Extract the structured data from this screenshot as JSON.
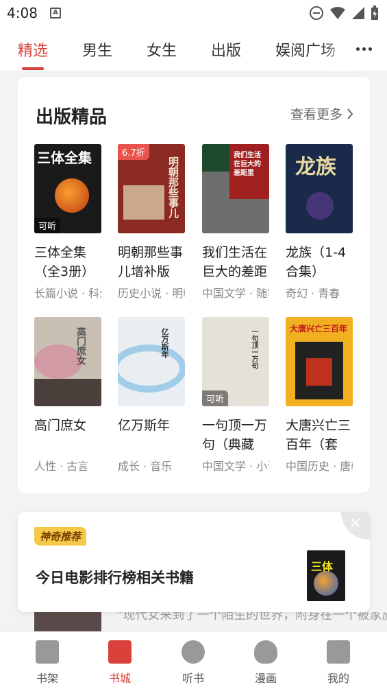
{
  "status": {
    "time": "4:08",
    "a_label": "A"
  },
  "tabs": [
    {
      "label": "精选",
      "active": true
    },
    {
      "label": "男生"
    },
    {
      "label": "女生"
    },
    {
      "label": "出版"
    },
    {
      "label": "娱阅广场"
    }
  ],
  "section": {
    "title": "出版精品",
    "see_more": "查看更多"
  },
  "books": [
    {
      "title": "三体全集（全3册）",
      "meta": "长篇小说 · 科幻",
      "badge": "可听",
      "cover_text": "三体全集",
      "cover_color": "#1a1a1a"
    },
    {
      "title": "明朝那些事儿增补版",
      "meta": "历史小说 · 明朝",
      "badge": "6.7折",
      "cover_text": "明朝那些事儿",
      "cover_color": "#8b2a22"
    },
    {
      "title": "我们生活在巨大的差距里",
      "meta": "中国文学 · 随笔",
      "badge": "",
      "cover_text": "我们生活在巨大的差距里",
      "cover_color": "#a02020"
    },
    {
      "title": "龙族（1-4合集）",
      "meta": "奇幻 · 青春",
      "badge": "",
      "cover_text": "龙族",
      "cover_color": "#1a2a4a"
    },
    {
      "title": "高门庶女",
      "meta": "人性 · 古言",
      "badge": "",
      "cover_text": "高门庶女",
      "cover_color": "#c9bfb2"
    },
    {
      "title": "亿万斯年",
      "meta": "成长 · 音乐",
      "badge": "",
      "cover_text": "亿万斯年",
      "cover_color": "#e9eef2"
    },
    {
      "title": "一句顶一万句（典藏版）",
      "meta": "中国文学 · 小说",
      "badge": "可听",
      "cover_text": "一句顶一万句",
      "cover_color": "#e5e0d8"
    },
    {
      "title": "大唐兴亡三百年（套装）",
      "meta": "中国历史 · 唐朝",
      "badge": "",
      "cover_text": "大唐兴亡三百年",
      "cover_color": "#f0b020"
    }
  ],
  "recommend": {
    "tag": "神奇推荐",
    "title": "今日电影排行榜相关书籍",
    "close": "✕",
    "cover_text": "三体"
  },
  "peek": {
    "text": "“现代女来到了一个陌生的世界，附身在一个被家族抛弃的宅院中，却因得到"
  },
  "nav": [
    {
      "label": "书架",
      "icon": "bookshelf-icon"
    },
    {
      "label": "书城",
      "icon": "bookstore-icon",
      "active": true
    },
    {
      "label": "听书",
      "icon": "headphones-icon"
    },
    {
      "label": "漫画",
      "icon": "bear-icon"
    },
    {
      "label": "我的",
      "icon": "profile-icon"
    }
  ]
}
